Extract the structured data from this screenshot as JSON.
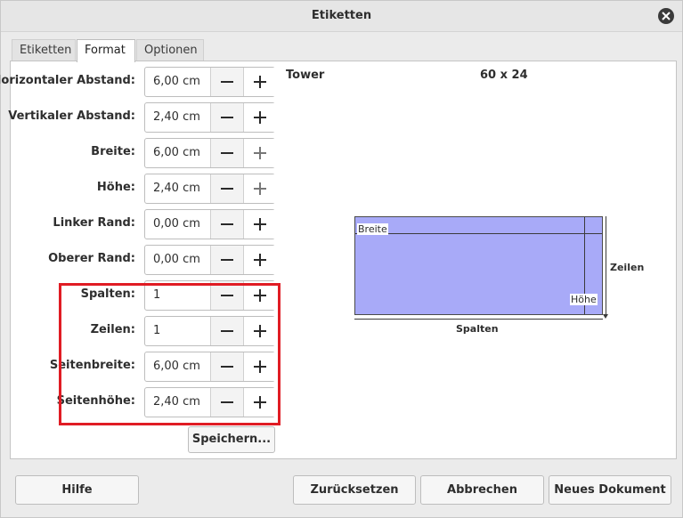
{
  "window": {
    "title": "Etiketten"
  },
  "tabs": [
    {
      "label": "Etiketten",
      "active": false
    },
    {
      "label": "Format",
      "active": true
    },
    {
      "label": "Optionen",
      "active": false
    }
  ],
  "fields": [
    {
      "label": "Horizontaler Abstand:",
      "value": "6,00 cm"
    },
    {
      "label": "Vertikaler Abstand:",
      "value": "2,40 cm"
    },
    {
      "label": "Breite:",
      "value": "6,00 cm"
    },
    {
      "label": "Höhe:",
      "value": "2,40 cm"
    },
    {
      "label": "Linker Rand:",
      "value": "0,00 cm"
    },
    {
      "label": "Oberer Rand:",
      "value": "0,00 cm"
    },
    {
      "label": "Spalten:",
      "value": "1"
    },
    {
      "label": "Zeilen:",
      "value": "1"
    },
    {
      "label": "Seitenbreite:",
      "value": "6,00 cm"
    },
    {
      "label": "Seitenhöhe:",
      "value": "2,40 cm"
    }
  ],
  "save_label": "Speichern...",
  "preview": {
    "brand": "Tower",
    "type": "60 x 24",
    "width_label": "Breite",
    "height_label": "Höhe",
    "columns_label": "Spalten",
    "rows_label": "Zeilen",
    "fill_color": "#a8aaf8"
  },
  "buttons": {
    "help": "Hilfe",
    "reset": "Zurücksetzen",
    "cancel": "Abbrechen",
    "new_document": "Neues Dokument"
  },
  "highlight_color": "#e01c24"
}
